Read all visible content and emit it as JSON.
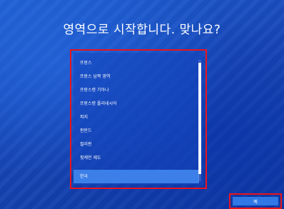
{
  "title": "영역으로 시작합니다. 맞나요?",
  "region_list": {
    "items": [
      {
        "label": "프랑스",
        "selected": false
      },
      {
        "label": "프랑스 남쪽 영역",
        "selected": false
      },
      {
        "label": "프랑스령 기아나",
        "selected": false
      },
      {
        "label": "프랑스령 폴리네시아",
        "selected": false
      },
      {
        "label": "피지",
        "selected": false
      },
      {
        "label": "핀란드",
        "selected": false
      },
      {
        "label": "필리핀",
        "selected": false
      },
      {
        "label": "핏케언 제도",
        "selected": false
      },
      {
        "label": "한국",
        "selected": true
      }
    ]
  },
  "yes_button": {
    "label": "예"
  },
  "colors": {
    "highlight": "#e8141c",
    "selected_item": "#3c7fe8",
    "button": "#2f78e6",
    "background": "#1747b8"
  }
}
